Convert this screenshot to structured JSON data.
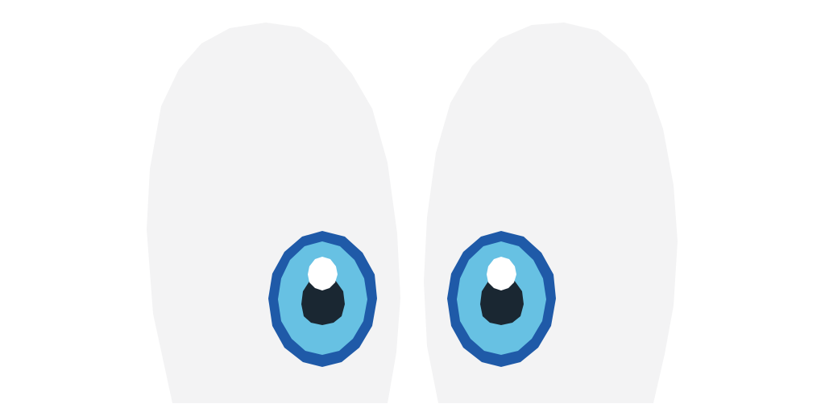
{
  "colors": {
    "background": "#ffffff",
    "eye_white": "#f3f3f4",
    "iris_ring": "#1f5aa8",
    "iris": "#67c1e3",
    "pupil": "#1a2732",
    "highlight": "#ffffff"
  },
  "eyes": [
    {
      "name": "left-eye"
    },
    {
      "name": "right-eye"
    }
  ]
}
